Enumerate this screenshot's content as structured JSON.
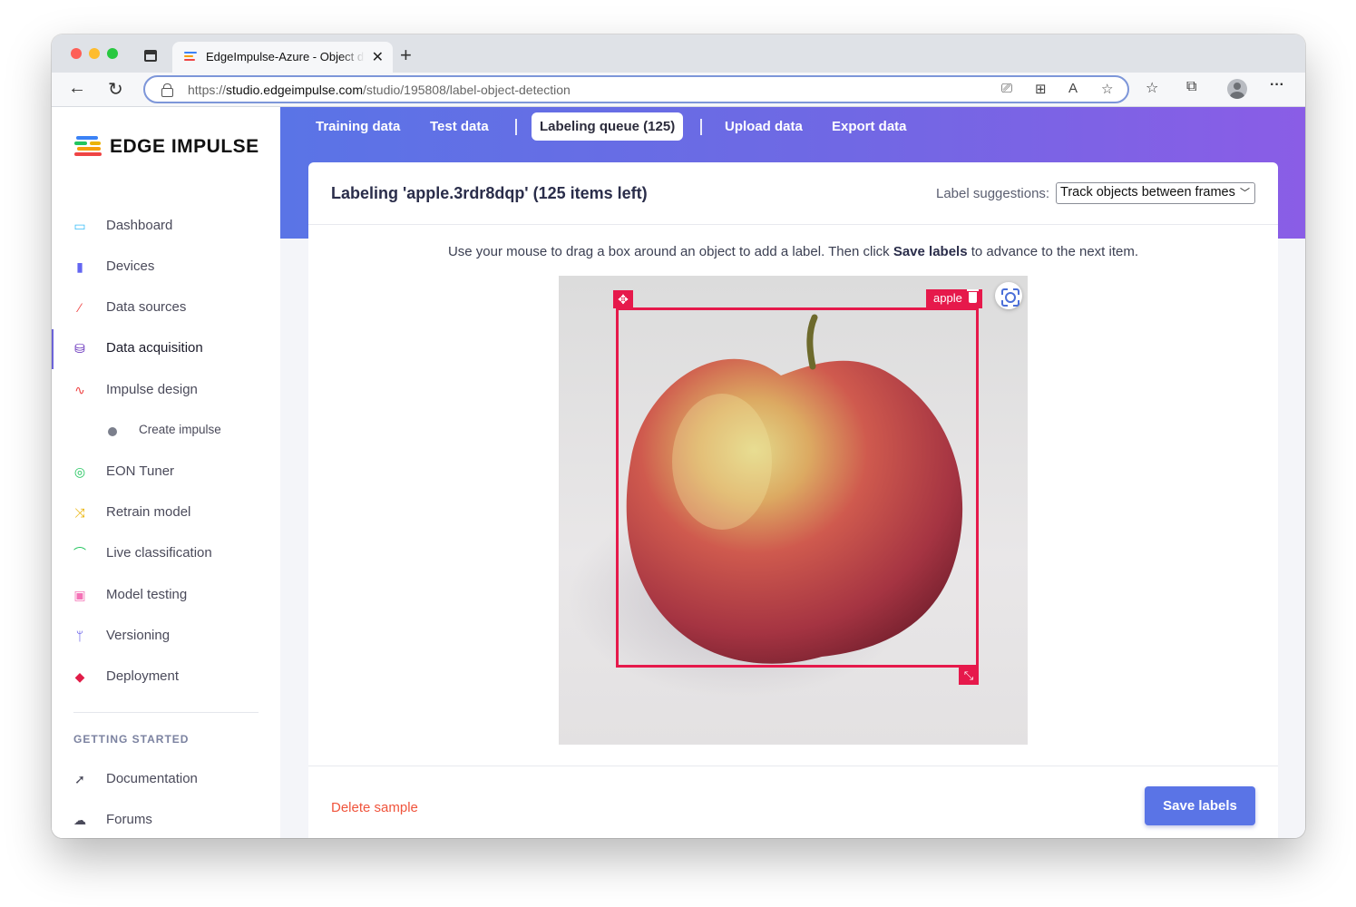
{
  "browser": {
    "tab_title": "EdgeImpulse-Azure - Object detection",
    "tab_close": "✕",
    "new_tab": "+",
    "url_prefix": "https://",
    "url_domain": "studio.edgeimpulse.com",
    "url_path": "/studio/195808/label-object-detection",
    "back": "←",
    "reload": "↻",
    "more": "···"
  },
  "sidebar": {
    "logo_text": "EDGE IMPULSE",
    "items": [
      {
        "label": "Dashboard",
        "icon": "monitor-icon",
        "color": "#38bdf8"
      },
      {
        "label": "Devices",
        "icon": "chip-icon",
        "color": "#6366f1"
      },
      {
        "label": "Data sources",
        "icon": "wand-icon",
        "color": "#ef4444"
      },
      {
        "label": "Data acquisition",
        "icon": "database-icon",
        "color": "#5b21b6"
      },
      {
        "label": "Impulse design",
        "icon": "pulse-icon",
        "color": "#ef4444"
      },
      {
        "label": "Create impulse",
        "icon": "dot-icon",
        "color": "#7b7f8c"
      },
      {
        "label": "EON Tuner",
        "icon": "compass-icon",
        "color": "#22c55e"
      },
      {
        "label": "Retrain model",
        "icon": "shuffle-icon",
        "color": "#eab308"
      },
      {
        "label": "Live classification",
        "icon": "curve-icon",
        "color": "#22c55e"
      },
      {
        "label": "Model testing",
        "icon": "clipboard-icon",
        "color": "#f472b6"
      },
      {
        "label": "Versioning",
        "icon": "branch-icon",
        "color": "#4f46e5"
      },
      {
        "label": "Deployment",
        "icon": "cube-icon",
        "color": "#e11d48"
      }
    ],
    "section_title": "GETTING STARTED",
    "extra_items": [
      {
        "label": "Documentation",
        "icon": "rocket-icon"
      },
      {
        "label": "Forums",
        "icon": "chat-icon"
      }
    ]
  },
  "topnav": {
    "training": "Training data",
    "test": "Test data",
    "queue": "Labeling queue (125)",
    "upload": "Upload data",
    "export": "Export data"
  },
  "card": {
    "title": "Labeling 'apple.3rdr8dqp' (125 items left)",
    "suggest_label": "Label suggestions:",
    "suggest_value": "Track objects between frames",
    "instr_before": "Use your mouse to drag a box around an object to add a label. Then click ",
    "instr_bold": "Save labels",
    "instr_after": " to advance to the next item.",
    "bbox_label": "apple",
    "delete": "Delete sample",
    "save": "Save labels"
  },
  "colors": {
    "accent": "#5a74e6",
    "bbox": "#e6194b",
    "delete": "#f0543c"
  }
}
